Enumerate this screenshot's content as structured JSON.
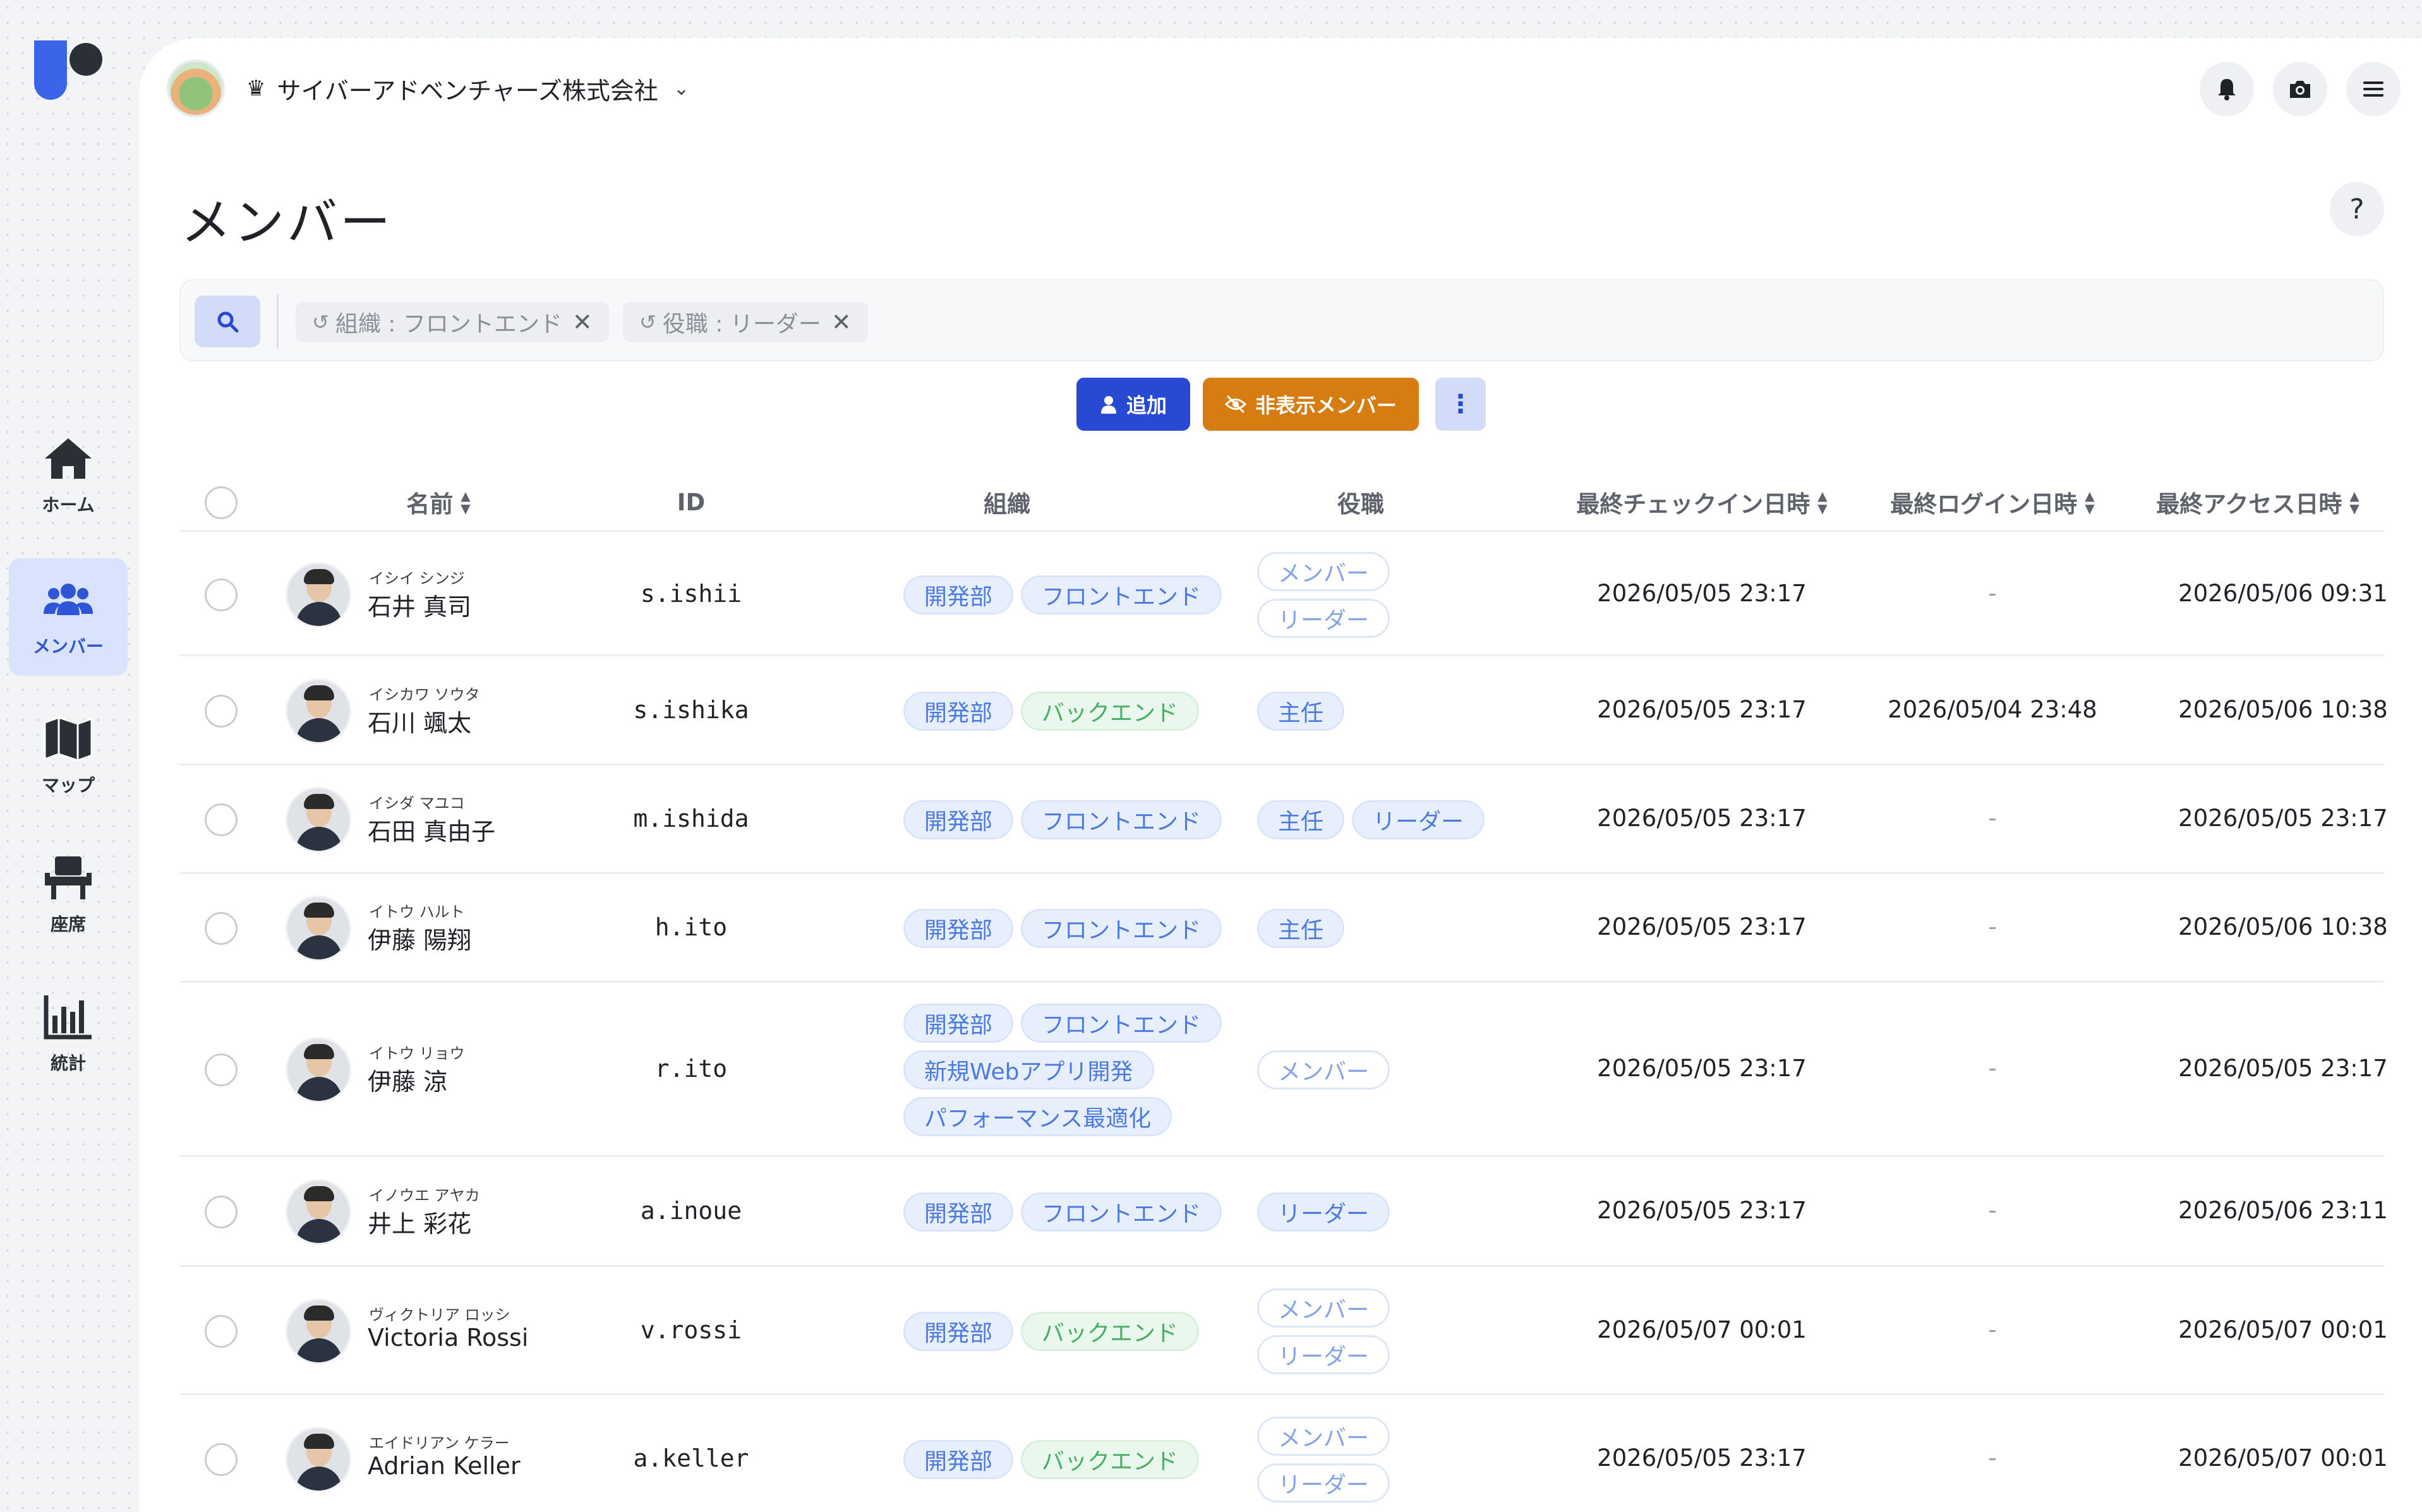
{
  "nav": {
    "items": [
      {
        "label": "ホーム",
        "icon": "home-icon"
      },
      {
        "label": "メンバー",
        "icon": "members-icon",
        "active": true
      },
      {
        "label": "マップ",
        "icon": "map-icon"
      },
      {
        "label": "座席",
        "icon": "seat-icon"
      },
      {
        "label": "統計",
        "icon": "stats-icon"
      }
    ]
  },
  "topbar": {
    "org_name": "サイバーアドベンチャーズ株式会社",
    "crown": "♛",
    "chevron": "⌄"
  },
  "page": {
    "title": "メンバー",
    "help": "?"
  },
  "filters": {
    "chip1": "組織 : フロントエンド",
    "chip2": "役職 : リーダー",
    "history_glyph": "↺",
    "remove_glyph": "✕"
  },
  "actions": {
    "add": "追加",
    "hidden": "非表示メンバー",
    "more": "⋮"
  },
  "table": {
    "headers": {
      "name": "名前",
      "id": "ID",
      "org": "組織",
      "role": "役職",
      "checkin": "最終チェックイン日時",
      "login": "最終ログイン日時",
      "access": "最終アクセス日時"
    },
    "rows": [
      {
        "kana": "イシイ シンジ",
        "name": "石井 真司",
        "id": "s.ishii",
        "orgs": [
          "開発部",
          "フロントエンド"
        ],
        "roles": [
          "メンバー",
          "リーダー"
        ],
        "checkin": "2026/05/05 23:17",
        "login": "-",
        "access": "2026/05/06 09:31"
      },
      {
        "kana": "イシカワ ソウタ",
        "name": "石川 颯太",
        "id": "s.ishika",
        "orgs": [
          "開発部",
          "バックエンド"
        ],
        "roles": [
          "主任"
        ],
        "checkin": "2026/05/05 23:17",
        "login": "2026/05/04 23:48",
        "access": "2026/05/06 10:38"
      },
      {
        "kana": "イシダ マユコ",
        "name": "石田 真由子",
        "id": "m.ishida",
        "orgs": [
          "開発部",
          "フロントエンド"
        ],
        "roles": [
          "主任",
          "リーダー"
        ],
        "checkin": "2026/05/05 23:17",
        "login": "-",
        "access": "2026/05/05 23:17"
      },
      {
        "kana": "イトウ ハルト",
        "name": "伊藤 陽翔",
        "id": "h.ito",
        "orgs": [
          "開発部",
          "フロントエンド"
        ],
        "roles": [
          "主任"
        ],
        "checkin": "2026/05/05 23:17",
        "login": "-",
        "access": "2026/05/06 10:38"
      },
      {
        "kana": "イトウ リョウ",
        "name": "伊藤 涼",
        "id": "r.ito",
        "orgs": [
          "開発部",
          "フロントエンド",
          "新規Webアプリ開発",
          "パフォーマンス最適化"
        ],
        "roles": [
          "メンバー"
        ],
        "checkin": "2026/05/05 23:17",
        "login": "-",
        "access": "2026/05/05 23:17"
      },
      {
        "kana": "イノウエ アヤカ",
        "name": "井上 彩花",
        "id": "a.inoue",
        "orgs": [
          "開発部",
          "フロントエンド"
        ],
        "roles": [
          "リーダー"
        ],
        "checkin": "2026/05/05 23:17",
        "login": "-",
        "access": "2026/05/06 23:11"
      },
      {
        "kana": "ヴィクトリア ロッシ",
        "name": "Victoria Rossi",
        "id": "v.rossi",
        "orgs": [
          "開発部",
          "バックエンド"
        ],
        "roles": [
          "メンバー",
          "リーダー"
        ],
        "checkin": "2026/05/07 00:01",
        "login": "-",
        "access": "2026/05/07 00:01"
      },
      {
        "kana": "エイドリアン ケラー",
        "name": "Adrian Keller",
        "id": "a.keller",
        "orgs": [
          "開発部",
          "バックエンド"
        ],
        "roles": [
          "メンバー",
          "リーダー"
        ],
        "checkin": "2026/05/05 23:17",
        "login": "-",
        "access": "2026/05/07 00:01"
      }
    ]
  },
  "colors": {
    "primary": "#2849d1",
    "warning": "#d67c10",
    "nav_active_bg": "#d9e3fb",
    "tag_blue": "#4c7ae0",
    "tag_green": "#48b066"
  }
}
